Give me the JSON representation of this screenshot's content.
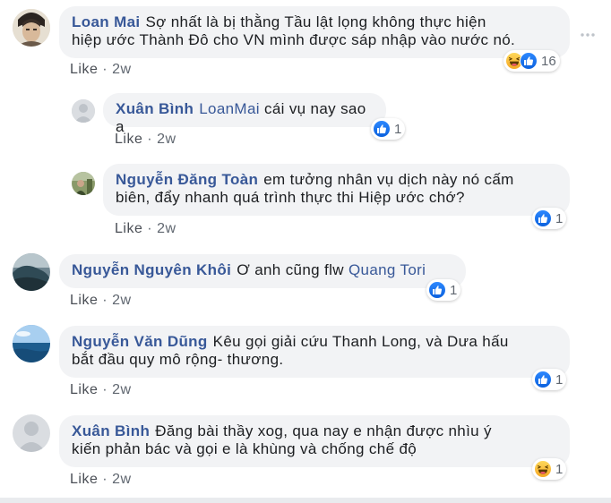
{
  "more_icon": "ellipsis-icon",
  "comments": [
    {
      "name": "Loan Mai",
      "text_line1": "Sợ nhất là bị thằng Tầu lật lọng không thực hiện",
      "text_line2": "hiệp ước Thành Đô cho VN mình được sáp nhập vào nước nó.",
      "like_label": "Like",
      "time": "2w",
      "reaction_count": "16",
      "reactions": [
        "haha-icon",
        "like-icon"
      ]
    },
    {
      "name": "Xuân Bình",
      "tag": "LoanMai",
      "text_line1": " cái vụ nay sao a",
      "like_label": "Like",
      "time": "2w",
      "reaction_count": "1",
      "reactions": [
        "like-icon"
      ]
    },
    {
      "name": "Nguyễn Đăng Toàn",
      "text_line1": "em tưởng nhân vụ dịch này nó cấm",
      "text_line2": "biên, đẩy nhanh quá trình thực thi Hiệp ước chớ?",
      "like_label": "Like",
      "time": "2w",
      "reaction_count": "1",
      "reactions": [
        "like-icon"
      ]
    },
    {
      "name": "Nguyễn Nguyên Khôi",
      "text_line1": "Ơ anh cũng flw ",
      "tag": "Quang Tori",
      "like_label": "Like",
      "time": "2w",
      "reaction_count": "1",
      "reactions": [
        "like-icon"
      ]
    },
    {
      "name": "Nguyễn Văn Dũng",
      "text_line1": "Kêu gọi giải cứu Thanh Long, và Dưa hấu",
      "text_line2": "bắt đầu quy mô rộng- thương.",
      "like_label": "Like",
      "time": "2w",
      "reaction_count": "1",
      "reactions": [
        "like-icon"
      ]
    },
    {
      "name": "Xuân Bình",
      "text_line1": "Đăng bài thầy xog, qua nay e nhận được nhìu ý",
      "text_line2": "kiến phản bác và gọi e là khùng và chống chế độ",
      "like_label": "Like",
      "time": "2w",
      "reaction_count": "1",
      "reactions": [
        "haha-icon"
      ]
    }
  ],
  "colors": {
    "name": "#385898",
    "bubble": "#f2f3f5",
    "like_blue": "#1877f2",
    "haha_yellow": "#f7b125"
  }
}
